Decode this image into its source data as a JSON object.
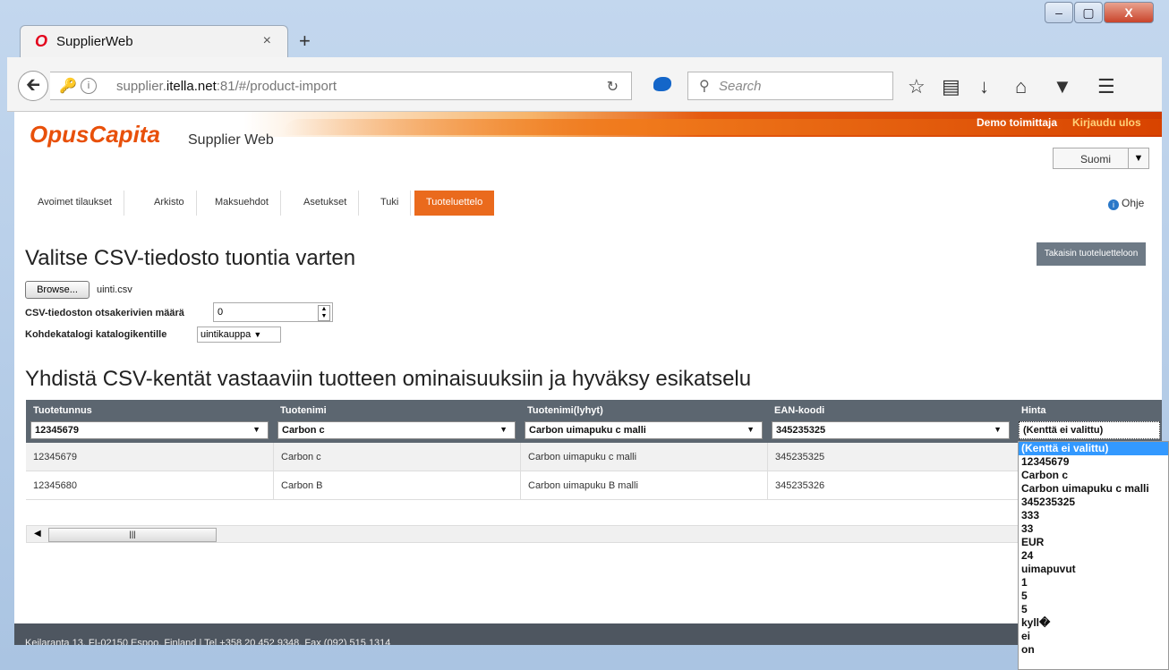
{
  "browser": {
    "tab_title": "SupplierWeb",
    "tab_close": "×",
    "new_tab": "+",
    "url_prefix": "supplier.",
    "url_domain": "itella.net",
    "url_rest": ":81/#/product-import",
    "search_placeholder": "Search",
    "window_buttons": {
      "minimize": "–",
      "maximize": "▢",
      "close": "X"
    }
  },
  "header": {
    "logo": "OpusCapita",
    "logo_sub": "Supplier Web",
    "user": "Demo toimittaja",
    "logout": "Kirjaudu ulos",
    "language": "Suomi"
  },
  "nav": {
    "tabs": [
      "Avoimet tilaukset",
      "Arkisto",
      "Maksuehdot",
      "Asetukset",
      "Tuki",
      "Tuoteluettelo"
    ],
    "active": "Tuoteluettelo",
    "help": "Ohje"
  },
  "main": {
    "title": "Valitse CSV-tiedosto tuontia varten",
    "back_button": "Takaisin tuoteluetteloon",
    "browse_label": "Browse...",
    "file_name": "uinti.csv",
    "header_rows_label": "CSV-tiedoston otsakerivien määrä",
    "header_rows_value": "0",
    "catalog_label": "Kohdekatalogi katalogikentille",
    "catalog_value": "uintikauppa",
    "mapping_title": "Yhdistä CSV-kentät vastaaviin tuotteen ominaisuuksiin ja hyväksy esikatselu"
  },
  "grid": {
    "columns": [
      {
        "header": "Tuotetunnus",
        "selected": "12345679"
      },
      {
        "header": "Tuotenimi",
        "selected": "Carbon c"
      },
      {
        "header": "Tuotenimi(lyhyt)",
        "selected": "Carbon uimapuku c malli"
      },
      {
        "header": "EAN-koodi",
        "selected": "345235325"
      },
      {
        "header": "Hinta",
        "selected": "(Kenttä ei valittu)"
      }
    ],
    "rows": [
      [
        "12345679",
        "Carbon c",
        "Carbon uimapuku c malli",
        "345235325"
      ],
      [
        "12345680",
        "Carbon B",
        "Carbon uimapuku B malli",
        "345235326"
      ]
    ]
  },
  "dropdown_options": [
    "(Kenttä ei valittu)",
    "12345679",
    "Carbon c",
    "Carbon uimapuku c malli",
    "345235325",
    "333",
    "33",
    "EUR",
    "24",
    "uimapuvut",
    "1",
    "5",
    "5",
    "kyll�",
    "ei",
    "on"
  ],
  "footer": {
    "text": "Keilaranta 13, FI-02150 Espoo, Finland | Tel +358 20 452 9348, Fax (092) 515 1314"
  },
  "colors": {
    "accent": "#ea6a1d",
    "grid_header": "#5c6670",
    "footer": "#4e5660",
    "dropdown_selected": "#3399ff"
  }
}
